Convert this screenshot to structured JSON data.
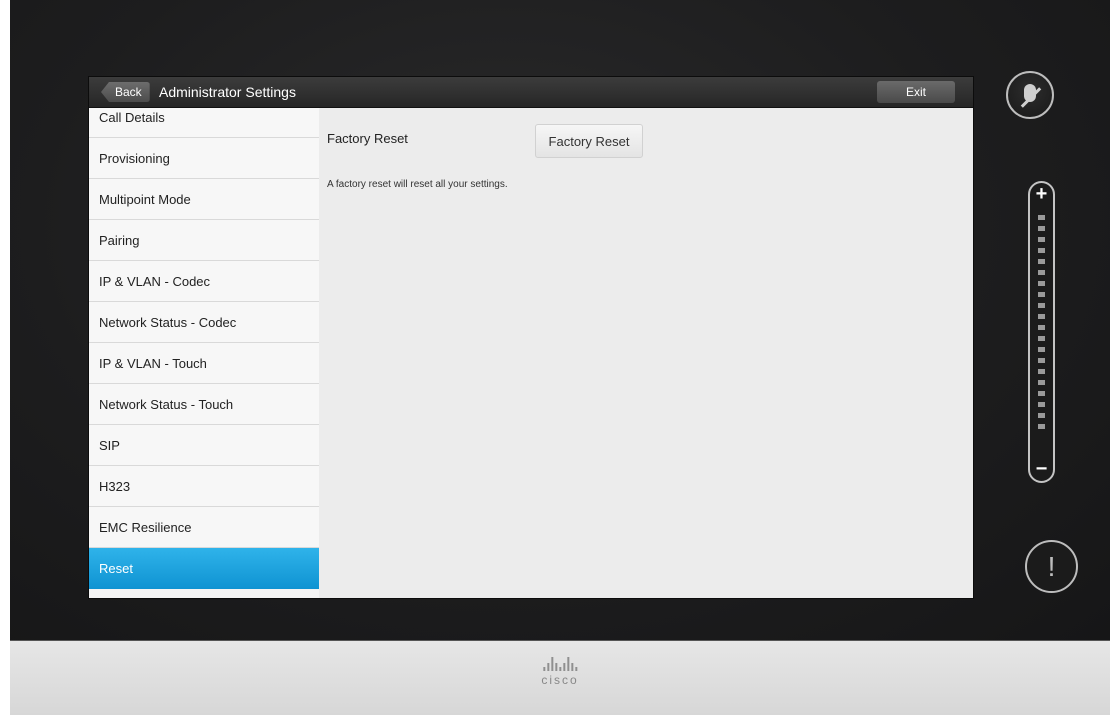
{
  "titlebar": {
    "back_label": "Back",
    "title": "Administrator Settings",
    "exit_label": "Exit"
  },
  "sidebar": {
    "items": [
      {
        "label": "Call Details"
      },
      {
        "label": "Provisioning"
      },
      {
        "label": "Multipoint Mode"
      },
      {
        "label": "Pairing"
      },
      {
        "label": "IP & VLAN - Codec"
      },
      {
        "label": "Network Status - Codec"
      },
      {
        "label": "IP & VLAN - Touch"
      },
      {
        "label": "Network Status - Touch"
      },
      {
        "label": "SIP"
      },
      {
        "label": "H323"
      },
      {
        "label": "EMC Resilience"
      },
      {
        "label": "Reset"
      }
    ],
    "active": "Reset"
  },
  "content": {
    "setting_label": "Factory Reset",
    "button_label": "Factory Reset",
    "description": "A factory reset will reset all your settings."
  },
  "controls": {
    "volume_plus": "+",
    "volume_minus": "−",
    "alert_mark": "!"
  },
  "brand": {
    "logo_text": "cisco"
  },
  "colors": {
    "active_item": "#1ba3e0",
    "titlebar": "#2c2c2c"
  }
}
